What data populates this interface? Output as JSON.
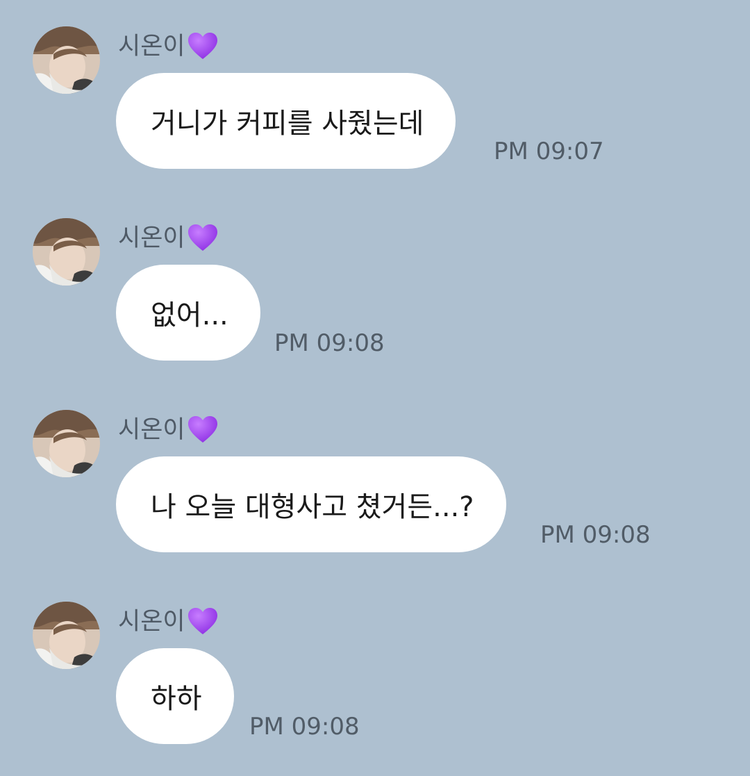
{
  "background_color": "#aec0d0",
  "messages": [
    {
      "sender": "시온이",
      "sender_emoji": "purple-heart-icon",
      "text": "거니가 커피를 사줬는데",
      "time": "PM 09:07"
    },
    {
      "sender": "시온이",
      "sender_emoji": "purple-heart-icon",
      "text": "없어...",
      "time": "PM 09:08"
    },
    {
      "sender": "시온이",
      "sender_emoji": "purple-heart-icon",
      "text": "나 오늘 대형사고 쳤거든...?",
      "time": "PM 09:08"
    },
    {
      "sender": "시온이",
      "sender_emoji": "purple-heart-icon",
      "text": "하하",
      "time": "PM 09:08"
    }
  ]
}
